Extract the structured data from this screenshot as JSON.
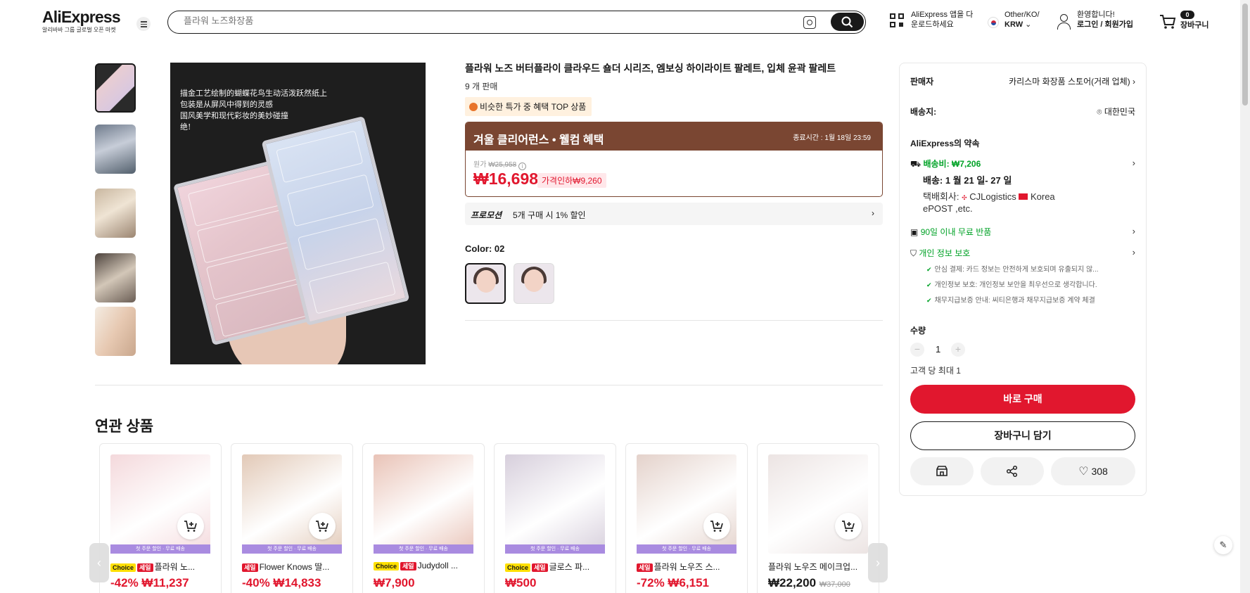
{
  "header": {
    "brand": "AliExpress",
    "tagline": "알리바바 그룹 글로벌 오픈 마켓",
    "search_placeholder": "플라워 노즈화장품",
    "app_line1": "AliExpress 앱을 다",
    "app_line2": "운로드하세요",
    "locale_line1": "Other/KO/",
    "locale_currency": "KRW",
    "welcome": "환영합니다!",
    "login": "로그인 / 회원가입",
    "cart_count": "0",
    "cart_label": "장바구니"
  },
  "product": {
    "title": "플라워 노즈 버터플라이 클라우드 숄더 시리즈, 엠보싱 하이라이트 팔레트, 입체 윤곽 팔레트",
    "sold": "9 개 판매",
    "top_badge": "비슷한 특가 중 혜택 TOP 상품",
    "image_caption": [
      "描金工艺绘制的蝴蝶花鸟生动活泼跃然纸上",
      "包装是从屏风中得到的灵感",
      "国风美学和现代彩妆的美妙碰撞",
      "绝!"
    ],
    "promo_title": "겨울 클리어런스 • 웰컴 혜택",
    "promo_end": "종료시간 : 1월 18일 23:59",
    "orig_label": "원가",
    "orig_price": "₩25,958",
    "price": "₩16,698",
    "discount": "가격인하₩9,260",
    "promotion_key": "프로모션",
    "promotion_value": "5개 구매 시 1% 할인",
    "color_label": "Color: 02",
    "swatch_count": 2
  },
  "panel": {
    "seller_label": "판매자",
    "seller_name": "카리스마 화장품 스토어(거래 업체)",
    "ship_to_label": "배송지:",
    "ship_to": "대한민국",
    "promise_title": "AliExpress의 약속",
    "shipping_fee": "배송비: ₩7,206",
    "delivery": "배송: 1 월 21 일- 27 일",
    "carrier_line1": "택배회사:",
    "carrier1": "CJLogistics",
    "carrier2": "Korea",
    "carrier_line2": "ePOST ,etc.",
    "return": "90일 이내 무료 반품",
    "privacy": "개인 정보 보호",
    "checks": [
      "안심 결제: 카드 정보는 안전하게 보호되며 유출되지 않...",
      "개인정보 보호: 개인정보 보안을 최우선으로 생각합니다.",
      "채무지급보증 안내: 씨티은행과 채무지급보증 계약 체결"
    ],
    "qty_label": "수량",
    "qty_value": "1",
    "qty_limit": "고객 당 최대 1",
    "buy_now": "바로 구매",
    "add_to_cart": "장바구니 담기",
    "wishlist_count": "308"
  },
  "related": {
    "title": "연관 상품",
    "strip_text": "첫 주문 할인 · 무료 배송",
    "items": [
      {
        "tags": [
          "Choice",
          "세일"
        ],
        "name": "플라워 노...",
        "discount": "-42%",
        "price": "₩11,237",
        "orig": "",
        "img_color": "#f4d9dc"
      },
      {
        "tags": [
          "세일"
        ],
        "name": "Flower Knows 딸...",
        "discount": "-40%",
        "price": "₩14,833",
        "orig": "",
        "img_color": "#e2c9b7"
      },
      {
        "tags": [
          "Choice",
          "세일"
        ],
        "name": "Judydoll ...",
        "discount": "",
        "price": "₩7,900",
        "orig": "",
        "img_color": "#e9c3b7"
      },
      {
        "tags": [
          "Choice",
          "세일"
        ],
        "name": "글로스 파...",
        "discount": "",
        "price": "₩500",
        "orig": "",
        "img_color": "#d7cfdc"
      },
      {
        "tags": [
          "세일"
        ],
        "name": "플라워 노우즈 스...",
        "discount": "-72%",
        "price": "₩6,151",
        "orig": "",
        "img_color": "#e4d2cb"
      },
      {
        "tags": [],
        "name": "플라워 노우즈 메이크업...",
        "discount": "",
        "price": "₩22,200",
        "orig": "₩37,000",
        "img_color": "#ece4e3"
      }
    ]
  }
}
